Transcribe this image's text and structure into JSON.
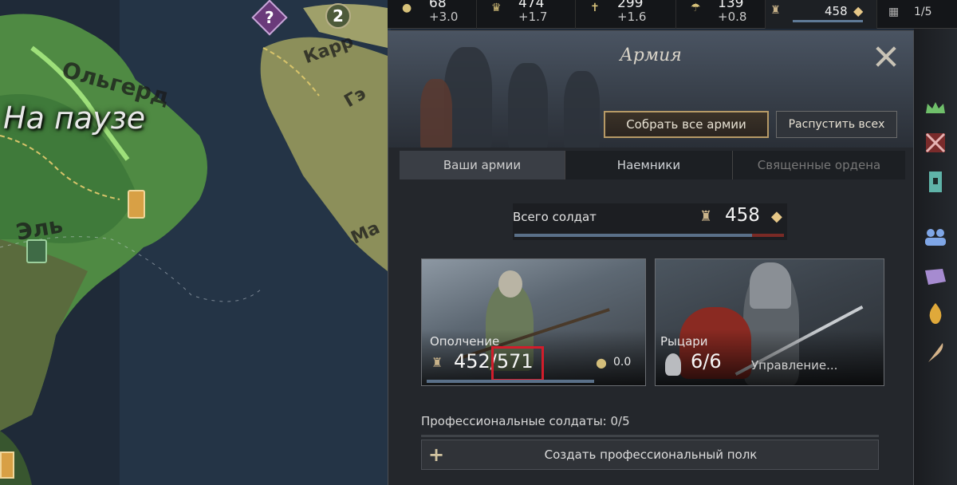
{
  "map": {
    "pause_label": "На паузе",
    "label_1": "Ольгерд",
    "label_2": "Эль",
    "label_3": "Карр",
    "label_4": "Гэ",
    "label_5": "Ма",
    "marker_event": "?",
    "marker_count": "2"
  },
  "topbar": {
    "resources": [
      {
        "icon": "gold-icon",
        "value": "68",
        "income": "+3.0"
      },
      {
        "icon": "prestige-icon",
        "value": "474",
        "income": "+1.7"
      },
      {
        "icon": "piety-icon",
        "value": "299",
        "income": "+1.6"
      },
      {
        "icon": "renown-icon",
        "value": "139",
        "income": "+0.8"
      }
    ],
    "army_total": "458",
    "domain": "1/5"
  },
  "panel": {
    "title": "Армия",
    "gather_button": "Собрать все армии",
    "disband_button": "Распустить всех",
    "tabs": [
      {
        "label": "Ваши армии",
        "active": true
      },
      {
        "label": "Наемники",
        "active": false
      },
      {
        "label": "Священные ордена",
        "active": false
      }
    ],
    "total_label": "Всего солдат",
    "total_value": "458",
    "levy": {
      "title": "Ополчение",
      "count": "452/571",
      "cost": "0.0"
    },
    "knights": {
      "title": "Рыцари",
      "count": "6/6",
      "manage": "Управление..."
    },
    "professional_label": "Профессиональные солдаты: 0/5",
    "create_button": "Создать профессиональный полк"
  },
  "colors": {
    "accent_gold": "#b79a66",
    "highlight_red": "#d21d2b",
    "bar_blue": "#5a7089",
    "panel_bg": "#24272c"
  }
}
